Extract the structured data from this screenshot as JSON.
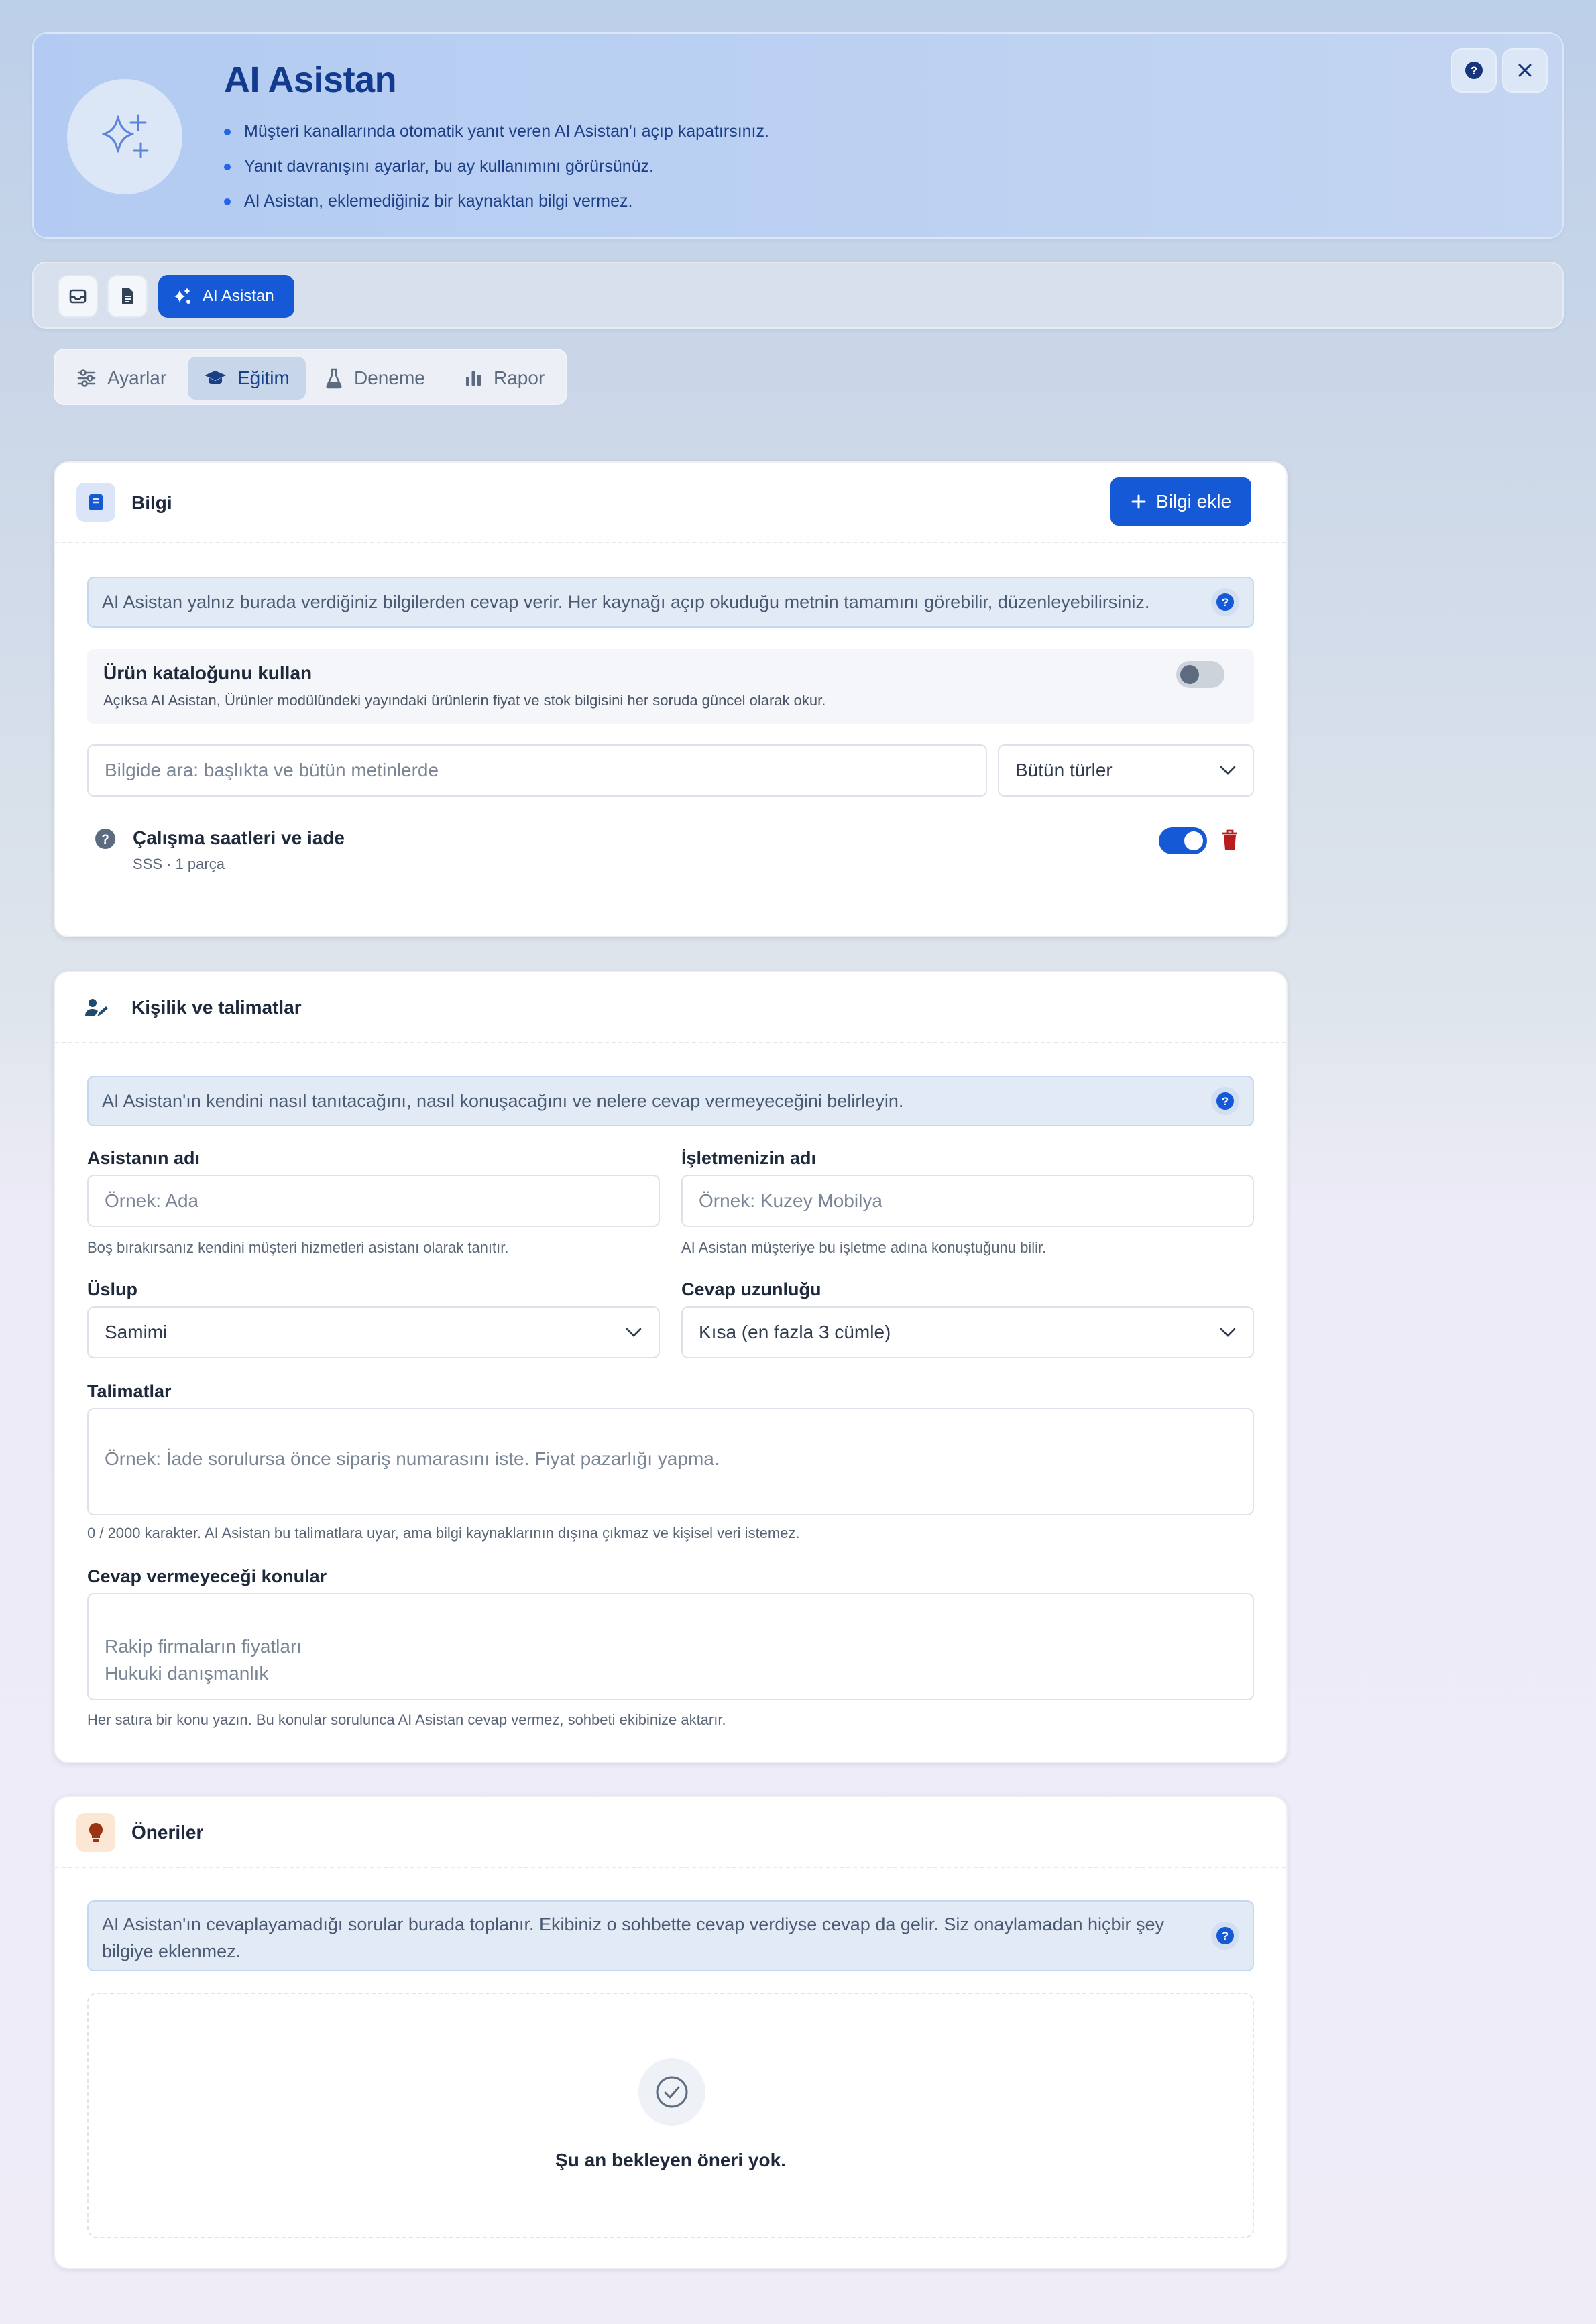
{
  "header": {
    "title": "AI Asistan",
    "bullets": [
      "Müşteri kanallarında otomatik yanıt veren AI Asistan'ı açıp kapatırsınız.",
      "Yanıt davranışını ayarlar, bu ay kullanımını görürsünüz.",
      "AI Asistan, eklemediğiniz bir kaynaktan bilgi vermez."
    ],
    "help_icon": "help-icon",
    "close_icon": "close-icon"
  },
  "modules": {
    "inbox_icon": "inbox-icon",
    "document_icon": "document-icon",
    "active_label": "AI Asistan"
  },
  "tabs": [
    {
      "label": "Ayarlar",
      "icon": "sliders-icon"
    },
    {
      "label": "Eğitim",
      "icon": "graduation-cap-icon",
      "active": true
    },
    {
      "label": "Deneme",
      "icon": "flask-icon"
    },
    {
      "label": "Rapor",
      "icon": "bar-chart-icon"
    }
  ],
  "knowledge": {
    "title": "Bilgi",
    "add_button": "Bilgi ekle",
    "info": "AI Asistan yalnız burada verdiğiniz bilgilerden cevap verir. Her kaynağı açıp okuduğu metnin tamamını görebilir, düzenleyebilirsiniz.",
    "catalog": {
      "title": "Ürün kataloğunu kullan",
      "description": "Açıksa AI Asistan, Ürünler modülündeki yayındaki ürünlerin fiyat ve stok bilgisini her soruda güncel olarak okur.",
      "enabled": false
    },
    "search_placeholder": "Bilgide ara: başlıkta ve bütün metinlerde",
    "type_filter": "Bütün türler",
    "items": [
      {
        "title": "Çalışma saatleri ve iade",
        "meta": "SSS · 1 parça",
        "enabled": true
      }
    ]
  },
  "persona": {
    "title": "Kişilik ve talimatlar",
    "info": "AI Asistan'ın kendini nasıl tanıtacağını, nasıl konuşacağını ve nelere cevap vermeyeceğini belirleyin.",
    "assistant_name": {
      "label": "Asistanın adı",
      "placeholder": "Örnek: Ada",
      "hint": "Boş bırakırsanız kendini müşteri hizmetleri asistanı olarak tanıtır."
    },
    "business_name": {
      "label": "İşletmenizin adı",
      "placeholder": "Örnek: Kuzey Mobilya",
      "hint": "AI Asistan müşteriye bu işletme adına konuştuğunu bilir."
    },
    "style": {
      "label": "Üslup",
      "value": "Samimi"
    },
    "length": {
      "label": "Cevap uzunluğu",
      "value": "Kısa (en fazla 3 cümle)"
    },
    "instructions": {
      "label": "Talimatlar",
      "placeholder": "Örnek: İade sorulursa önce sipariş numarasını iste. Fiyat pazarlığı yapma.",
      "hint": "0 / 2000 karakter. AI Asistan bu talimatlara uyar, ama bilgi kaynaklarının dışına çıkmaz ve kişisel veri istemez."
    },
    "forbidden": {
      "label": "Cevap vermeyeceği konular",
      "value": "Rakip firmaların fiyatları\nHukuki danışmanlık",
      "hint": "Her satıra bir konu yazın. Bu konular sorulunca AI Asistan cevap vermez, sohbeti ekibinize aktarır."
    }
  },
  "suggestions": {
    "title": "Öneriler",
    "info": "AI Asistan'ın cevaplayamadığı sorular burada toplanır. Ekibiniz o sohbette cevap verdiyse cevap da gelir. Siz onaylamadan hiçbir şey bilgiye eklenmez.",
    "empty": "Şu an bekleyen öneri yok."
  },
  "colors": {
    "primary": "#1559d6",
    "danger": "#b91c1c",
    "title": "#123b8f"
  }
}
